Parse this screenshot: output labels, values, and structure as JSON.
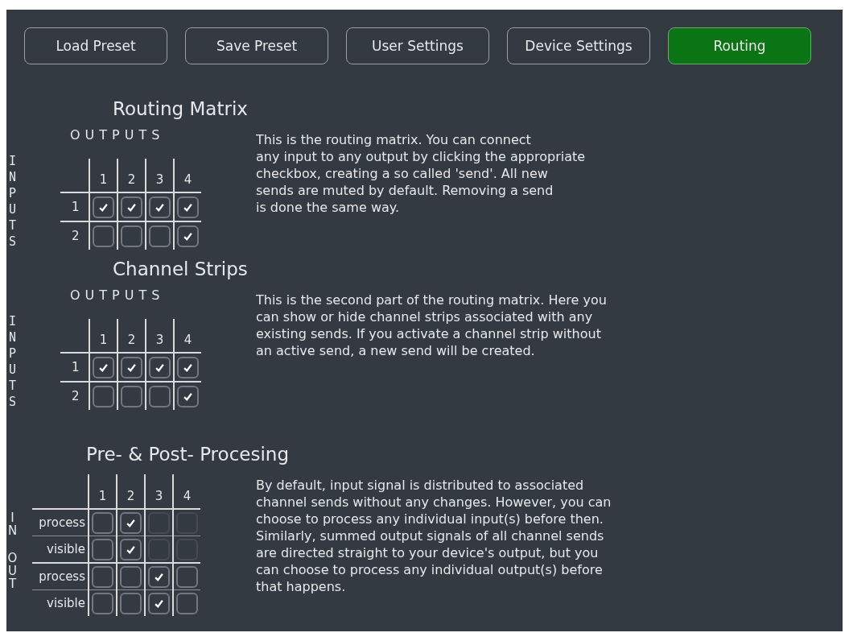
{
  "toolbar": {
    "buttons": [
      {
        "label": "Load Preset",
        "selected": false
      },
      {
        "label": "Save Preset",
        "selected": false
      },
      {
        "label": "User Settings",
        "selected": false
      },
      {
        "label": "Device Settings",
        "selected": false
      },
      {
        "label": "Routing",
        "selected": true
      }
    ]
  },
  "sections": [
    {
      "kind": "matrix",
      "title": "Routing Matrix",
      "column_axis": "OUTPUTS",
      "row_axis": "INPUTS",
      "columns": [
        "1",
        "2",
        "3",
        "4"
      ],
      "rows": [
        {
          "label": "1",
          "cells": [
            {
              "checked": true
            },
            {
              "checked": true
            },
            {
              "checked": true
            },
            {
              "checked": true
            }
          ]
        },
        {
          "label": "2",
          "cells": [
            {
              "checked": false
            },
            {
              "checked": false
            },
            {
              "checked": false
            },
            {
              "checked": true
            }
          ]
        }
      ],
      "description": "This is the routing matrix. You can connect\nany input to any output by clicking the appropriate\ncheckbox, creating a so called 'send'. All new\nsends are muted by default. Removing a send\nis done the same way."
    },
    {
      "kind": "matrix",
      "title": "Channel Strips",
      "column_axis": "OUTPUTS",
      "row_axis": "INPUTS",
      "columns": [
        "1",
        "2",
        "3",
        "4"
      ],
      "rows": [
        {
          "label": "1",
          "cells": [
            {
              "checked": true
            },
            {
              "checked": true
            },
            {
              "checked": true
            },
            {
              "checked": true
            }
          ]
        },
        {
          "label": "2",
          "cells": [
            {
              "checked": false
            },
            {
              "checked": false
            },
            {
              "checked": false
            },
            {
              "checked": true
            }
          ]
        }
      ],
      "description": "This is the second part of the routing matrix. Here you\ncan show or hide channel strips associated with any\nexisting sends. If you activate a channel strip without\nan active send, a new send will be created."
    },
    {
      "kind": "grouped",
      "title": "Pre- & Post- Procesing",
      "columns": [
        "1",
        "2",
        "3",
        "4"
      ],
      "groups": [
        {
          "label": "IN",
          "rows": [
            {
              "label": "process",
              "cells": [
                {
                  "checked": false,
                  "disabled": false
                },
                {
                  "checked": true,
                  "disabled": false
                },
                {
                  "checked": false,
                  "disabled": true
                },
                {
                  "checked": false,
                  "disabled": true
                }
              ]
            },
            {
              "label": "visible",
              "cells": [
                {
                  "checked": false,
                  "disabled": false
                },
                {
                  "checked": true,
                  "disabled": false
                },
                {
                  "checked": false,
                  "disabled": true
                },
                {
                  "checked": false,
                  "disabled": true
                }
              ]
            }
          ]
        },
        {
          "label": "OUT",
          "rows": [
            {
              "label": "process",
              "cells": [
                {
                  "checked": false,
                  "disabled": false
                },
                {
                  "checked": false,
                  "disabled": false
                },
                {
                  "checked": true,
                  "disabled": false
                },
                {
                  "checked": false,
                  "disabled": false
                }
              ]
            },
            {
              "label": "visible",
              "cells": [
                {
                  "checked": false,
                  "disabled": false
                },
                {
                  "checked": false,
                  "disabled": false
                },
                {
                  "checked": true,
                  "disabled": false
                },
                {
                  "checked": false,
                  "disabled": false
                }
              ]
            }
          ]
        }
      ],
      "description": "By default, input signal is distributed to associated\nchannel sends without any changes. However, you can\nchoose to process any individual input(s) before then.\nSimilarly, summed output signals of all channel sends\nare directed straight to your device's output, but you\ncan choose to process any individual output(s) before\nthat happens."
    }
  ]
}
